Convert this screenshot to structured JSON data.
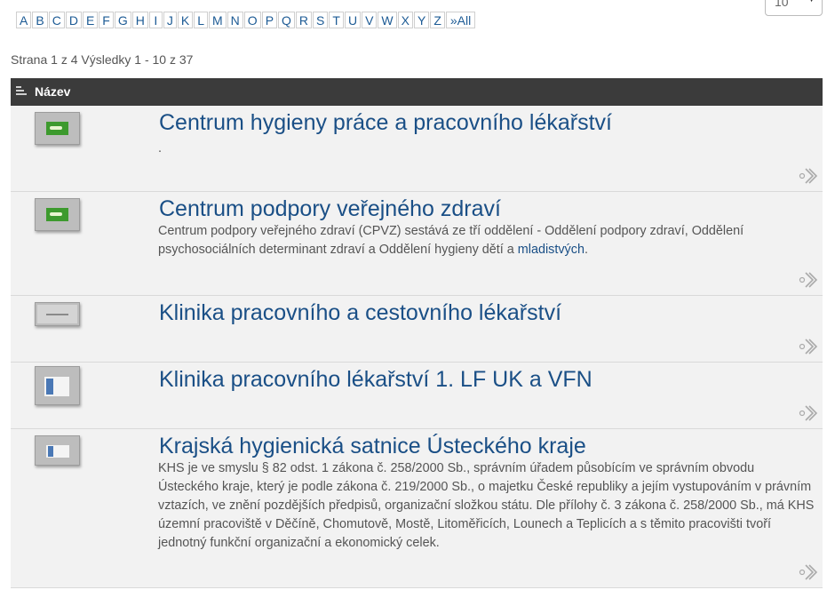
{
  "alphabet": [
    "A",
    "B",
    "C",
    "D",
    "E",
    "F",
    "G",
    "H",
    "I",
    "J",
    "K",
    "L",
    "M",
    "N",
    "O",
    "P",
    "Q",
    "R",
    "S",
    "T",
    "U",
    "V",
    "W",
    "X",
    "Y",
    "Z",
    "»All"
  ],
  "per_page": {
    "value": "10"
  },
  "paging": {
    "text": "Strana 1 z 4 Výsledky 1 - 10 z 37"
  },
  "table": {
    "header": "Název"
  },
  "rows": [
    {
      "title": "Centrum hygieny práce a pracovního lékařství",
      "desc": "."
    },
    {
      "title": "Centrum podpory veřejného zdraví",
      "desc_before": "Centrum podpory veřejného zdraví (CPVZ) sestává ze tří oddělení - Oddělení podpory zdraví, Oddělení psychosociálních determinant zdraví a Oddělení hygieny dětí a ",
      "desc_link": "mladistvých",
      "desc_after": "."
    },
    {
      "title": "Klinika pracovního a cestovního lékařství"
    },
    {
      "title": "Klinika pracovního lékařství 1. LF UK a VFN"
    },
    {
      "title": "Krajská hygienická satnice Ústeckého kraje",
      "desc": "KHS je ve smyslu § 82 odst. 1 zákona č. 258/2000 Sb., správním úřadem působícím ve správním obvodu Ústeckého kraje, který je podle zákona č. 219/2000 Sb., o majetku České republiky a jejím vystupováním v právním vztazích, ve znění pozdějších předpisů, organizační složkou státu. Dle přílohy č. 3 zákona č. 258/2000 Sb., má KHS územní pracoviště v Děčíně, Chomutově, Mostě, Litoměřicích, Lounech a Teplicích a s těmito pracovišti tvoří jednotný funkční organizační a ekonomický celek."
    }
  ],
  "colors": {
    "header_bg": "#3b3b3b",
    "row_bg": "#f2f2f2",
    "title": "#1a4f86",
    "alpha_link": "#1d5b95"
  },
  "icons": {
    "more": "more-arrow-icon",
    "sort": "sort-icon"
  }
}
